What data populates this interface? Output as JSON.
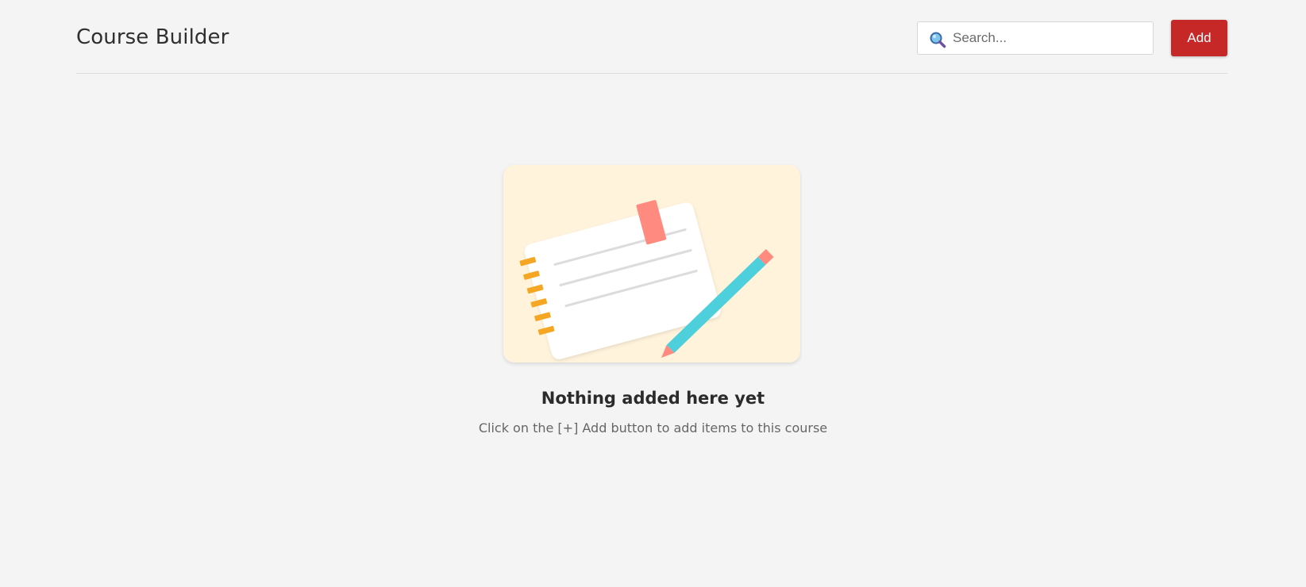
{
  "header": {
    "title": "Course Builder",
    "search": {
      "placeholder": "Search...",
      "value": "",
      "icon": "search-icon"
    },
    "add_button_label": "Add"
  },
  "empty_state": {
    "illustration": "notebook-and-pencil-illustration",
    "title": "Nothing added here yet",
    "description": "Click on the [+] Add button to add items to this course"
  },
  "colors": {
    "background": "#f4f4f4",
    "accent": "#c62828",
    "illustration_bg": "#fff3dc",
    "pencil": "#4ecfdc",
    "bookmark": "#ff8a80",
    "spiral": "#f5a623"
  }
}
